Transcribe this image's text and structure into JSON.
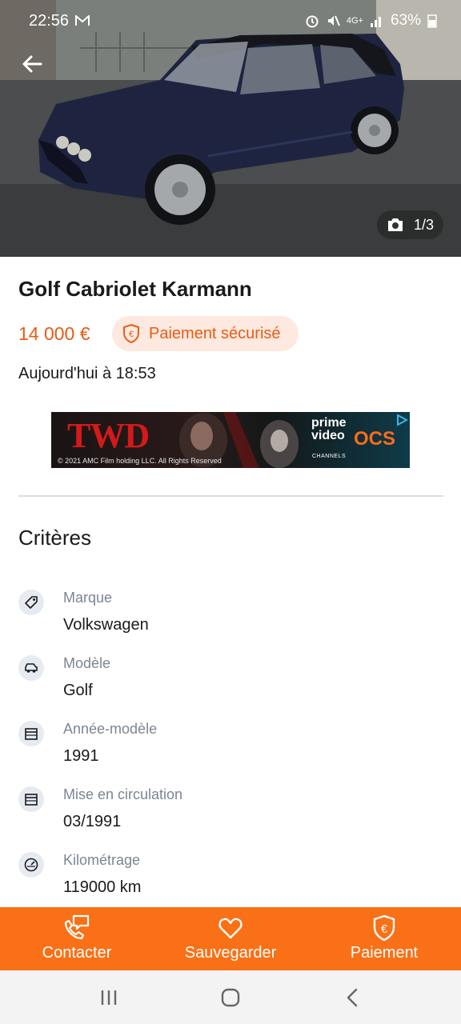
{
  "status_bar": {
    "time": "22:56",
    "battery": "63%",
    "network": "4G+"
  },
  "gallery": {
    "counter": "1/3"
  },
  "listing": {
    "title": "Golf Cabriolet Karmann",
    "price": "14 000 €",
    "secure_payment_label": "Paiement sécurisé",
    "date": "Aujourd'hui à 18:53"
  },
  "ad": {
    "headline": "TWD",
    "copyright": "© 2021 AMC Film holding LLC. All Rights Reserved",
    "brand_line1": "prime",
    "brand_line2": "video",
    "brand_sub": "CHANNELS",
    "partner": "OCS"
  },
  "criteria": {
    "title": "Critères",
    "items": [
      {
        "label": "Marque",
        "value": "Volkswagen",
        "icon": "tag-icon"
      },
      {
        "label": "Modèle",
        "value": "Golf",
        "icon": "car-icon"
      },
      {
        "label": "Année-modèle",
        "value": "1991",
        "icon": "calendar-icon"
      },
      {
        "label": "Mise en circulation",
        "value": "03/1991",
        "icon": "calendar-icon"
      },
      {
        "label": "Kilométrage",
        "value": "119000 km",
        "icon": "speedometer-icon"
      }
    ]
  },
  "actions": {
    "contact": "Contacter",
    "save": "Sauvegarder",
    "payment": "Paiement"
  },
  "colors": {
    "accent": "#fa7016",
    "price": "#ec5a13",
    "badge_bg": "#fde9df"
  }
}
